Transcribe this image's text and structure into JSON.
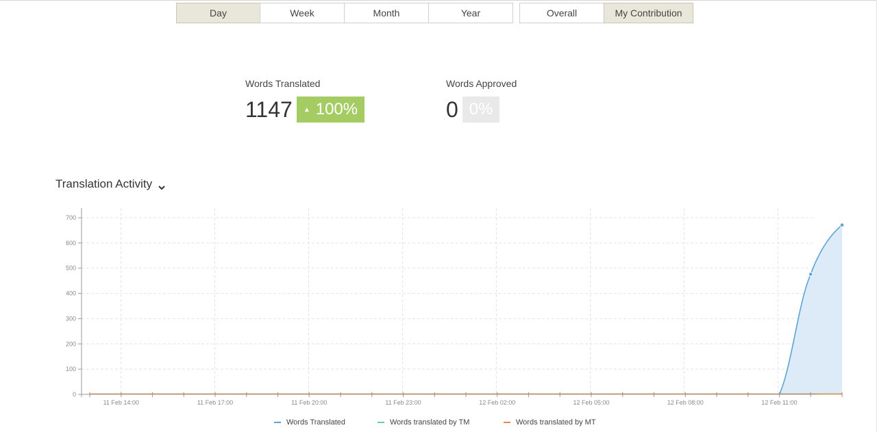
{
  "period_tabs": [
    {
      "label": "Day",
      "active": true
    },
    {
      "label": "Week",
      "active": false
    },
    {
      "label": "Month",
      "active": false
    },
    {
      "label": "Year",
      "active": false
    }
  ],
  "scope_tabs": [
    {
      "label": "Overall",
      "active": false
    },
    {
      "label": "My Contribution",
      "active": true
    }
  ],
  "stats": {
    "translated": {
      "label": "Words Translated",
      "value": "1147",
      "change": "100%",
      "change_dir": "up"
    },
    "approved": {
      "label": "Words Approved",
      "value": "0",
      "change": "0%"
    }
  },
  "activity": {
    "title": "Translation Activity"
  },
  "colors": {
    "translated": "#5ba4d6",
    "tm": "#6ccf9b",
    "mt": "#e0894b",
    "badge_up": "#a5cc63"
  },
  "chart_data": {
    "type": "area",
    "title": "",
    "xlabel": "",
    "ylabel": "",
    "ylim": [
      0,
      700
    ],
    "yticks": [
      0,
      100,
      200,
      300,
      400,
      500,
      600,
      700
    ],
    "x_labels": [
      "11 Feb 14:00",
      "11 Feb 17:00",
      "11 Feb 20:00",
      "11 Feb 23:00",
      "12 Feb 02:00",
      "12 Feb 05:00",
      "12 Feb 08:00",
      "12 Feb 11:00"
    ],
    "x": [
      "11 Feb 13:00",
      "11 Feb 14:00",
      "11 Feb 15:00",
      "11 Feb 16:00",
      "11 Feb 17:00",
      "11 Feb 18:00",
      "11 Feb 19:00",
      "11 Feb 20:00",
      "11 Feb 21:00",
      "11 Feb 22:00",
      "11 Feb 23:00",
      "12 Feb 00:00",
      "12 Feb 01:00",
      "12 Feb 02:00",
      "12 Feb 03:00",
      "12 Feb 04:00",
      "12 Feb 05:00",
      "12 Feb 06:00",
      "12 Feb 07:00",
      "12 Feb 08:00",
      "12 Feb 09:00",
      "12 Feb 10:00",
      "12 Feb 11:00",
      "12 Feb 12:00",
      "12 Feb 13:00"
    ],
    "grid": true,
    "legend": "bottom-center",
    "series": [
      {
        "name": "Words Translated",
        "values": [
          0,
          0,
          0,
          0,
          0,
          0,
          0,
          0,
          0,
          0,
          0,
          0,
          0,
          0,
          0,
          0,
          0,
          0,
          0,
          0,
          0,
          0,
          0,
          476,
          671
        ]
      },
      {
        "name": "Words translated by TM",
        "values": [
          0,
          0,
          0,
          0,
          0,
          0,
          0,
          0,
          0,
          0,
          0,
          0,
          0,
          0,
          0,
          0,
          0,
          0,
          0,
          0,
          0,
          0,
          0,
          0,
          0
        ]
      },
      {
        "name": "Words translated by MT",
        "values": [
          0,
          0,
          0,
          0,
          0,
          0,
          0,
          0,
          0,
          0,
          0,
          0,
          0,
          0,
          0,
          0,
          0,
          0,
          0,
          0,
          0,
          0,
          0,
          0,
          0
        ]
      }
    ]
  }
}
